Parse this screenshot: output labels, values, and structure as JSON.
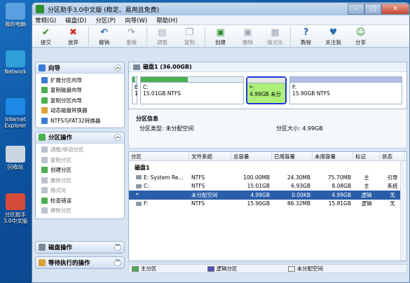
{
  "desktop": {
    "icons": [
      {
        "label": "我的电脑"
      },
      {
        "label": "Network"
      },
      {
        "label": "Internet Explorer"
      },
      {
        "label": "回收站"
      },
      {
        "label": "分区助手3.0中文版"
      }
    ]
  },
  "window": {
    "title": "分区助手3.0中文版 (稳定、易用且免费)",
    "min": "–",
    "max": "□",
    "close": "✕"
  },
  "menu": [
    "常规(G)",
    "磁盘(D)",
    "分区(P)",
    "向导(W)",
    "帮助(H)"
  ],
  "toolbar": [
    {
      "label": "提交",
      "icon": "check-icon",
      "glyph": "✔",
      "color": "#2e8b2e",
      "enabled": true
    },
    {
      "label": "放弃",
      "icon": "discard-icon",
      "glyph": "✖",
      "color": "#d02a2a",
      "enabled": true
    },
    {
      "label": "撤销",
      "icon": "undo-icon",
      "glyph": "↶",
      "color": "#2d6bb5",
      "enabled": true
    },
    {
      "label": "重做",
      "icon": "redo-icon",
      "glyph": "↷",
      "color": "#9aa7b5",
      "enabled": false
    },
    {
      "label": "调整",
      "icon": "resize-icon",
      "glyph": "▤",
      "color": "#9aa7b5",
      "enabled": false
    },
    {
      "label": "复制",
      "icon": "copy-icon",
      "glyph": "❐",
      "color": "#9aa7b5",
      "enabled": false
    },
    {
      "label": "创建",
      "icon": "create-icon",
      "glyph": "▣",
      "color": "#2e8b2e",
      "enabled": true
    },
    {
      "label": "删除",
      "icon": "delete-icon",
      "glyph": "▣",
      "color": "#9aa7b5",
      "enabled": false
    },
    {
      "label": "格式化",
      "icon": "format-icon",
      "glyph": "▦",
      "color": "#9aa7b5",
      "enabled": false
    },
    {
      "label": "教程",
      "icon": "tutorial-icon",
      "glyph": "?",
      "color": "#2d6bb5",
      "enabled": true
    },
    {
      "label": "关注我",
      "icon": "follow-icon",
      "glyph": "♥",
      "color": "#2d6bb5",
      "enabled": true
    },
    {
      "label": "分享",
      "icon": "share-icon",
      "glyph": "☺",
      "color": "#2e8b2e",
      "enabled": true
    }
  ],
  "wizard_panel": {
    "title": "向导",
    "items": [
      "扩展分区向导",
      "复制磁盘向导",
      "复制分区向导",
      "动态磁盘转换器",
      "NTFS与FAT32转换器"
    ]
  },
  "partition_panel": {
    "title": "分区操作",
    "items": [
      {
        "label": "调整/移动分区",
        "enabled": false
      },
      {
        "label": "复制分区",
        "enabled": false
      },
      {
        "label": "创建分区",
        "enabled": true
      },
      {
        "label": "删除分区",
        "enabled": false
      },
      {
        "label": "格式化",
        "enabled": false
      },
      {
        "label": "检查错误",
        "enabled": true
      },
      {
        "label": "擦除分区",
        "enabled": false
      }
    ]
  },
  "disk_panel": {
    "title": "磁盘操作"
  },
  "pending_panel": {
    "title": "等待执行的操作"
  },
  "disk_map": {
    "title": "磁盘1 (36.00GB)",
    "parts": [
      {
        "name": "E",
        "l1": "E",
        "l2": "1",
        "fill": 0.6,
        "color": "#4caf50"
      },
      {
        "name": "C",
        "l1": "C:",
        "l2": "15.01GB NTFS",
        "fill": 0.46,
        "color": "#4caf50"
      },
      {
        "name": "unalloc",
        "l1": "*:",
        "l2": "4.99GB 未分",
        "fill": 0.0,
        "color": "#e6e6e6"
      },
      {
        "name": "F",
        "l1": "F:",
        "l2": "15.90GB NTFS",
        "fill": 0.0,
        "color": "#b3bde8"
      }
    ]
  },
  "info": {
    "title": "分区信息",
    "type_label": "分区类型: 未分配空间",
    "size_label": "分区大小: 4.99GB"
  },
  "table": {
    "headers": [
      "分区",
      "文件系统",
      "总容量",
      "已用容量",
      "未用容量",
      "标记",
      "状态"
    ],
    "disk_label": "磁盘1",
    "rows": [
      {
        "part": "E: System Re...",
        "fs": "NTFS",
        "total": "100.00MB",
        "used": "24.30MB",
        "free": "75.70MB",
        "flag": "主",
        "status": "引导",
        "sel": false,
        "icon": true
      },
      {
        "part": "C:",
        "fs": "NTFS",
        "total": "15.01GB",
        "used": "6.93GB",
        "free": "8.08GB",
        "flag": "主",
        "status": "系统",
        "sel": false,
        "icon": true
      },
      {
        "part": "*",
        "fs": "未分配空间",
        "total": "4.99GB",
        "used": "0.00KB",
        "free": "4.99GB",
        "flag": "逻辑",
        "status": "无",
        "sel": true,
        "icon": false
      },
      {
        "part": "F:",
        "fs": "NTFS",
        "total": "15.90GB",
        "used": "86.32MB",
        "free": "15.81GB",
        "flag": "逻辑",
        "status": "无",
        "sel": false,
        "icon": true
      }
    ]
  },
  "legend": [
    {
      "label": "主分区",
      "color": "#4caf50"
    },
    {
      "label": "逻辑分区",
      "color": "#4a52b8"
    },
    {
      "label": "未分配空间",
      "color": "#f0f0f0"
    }
  ]
}
